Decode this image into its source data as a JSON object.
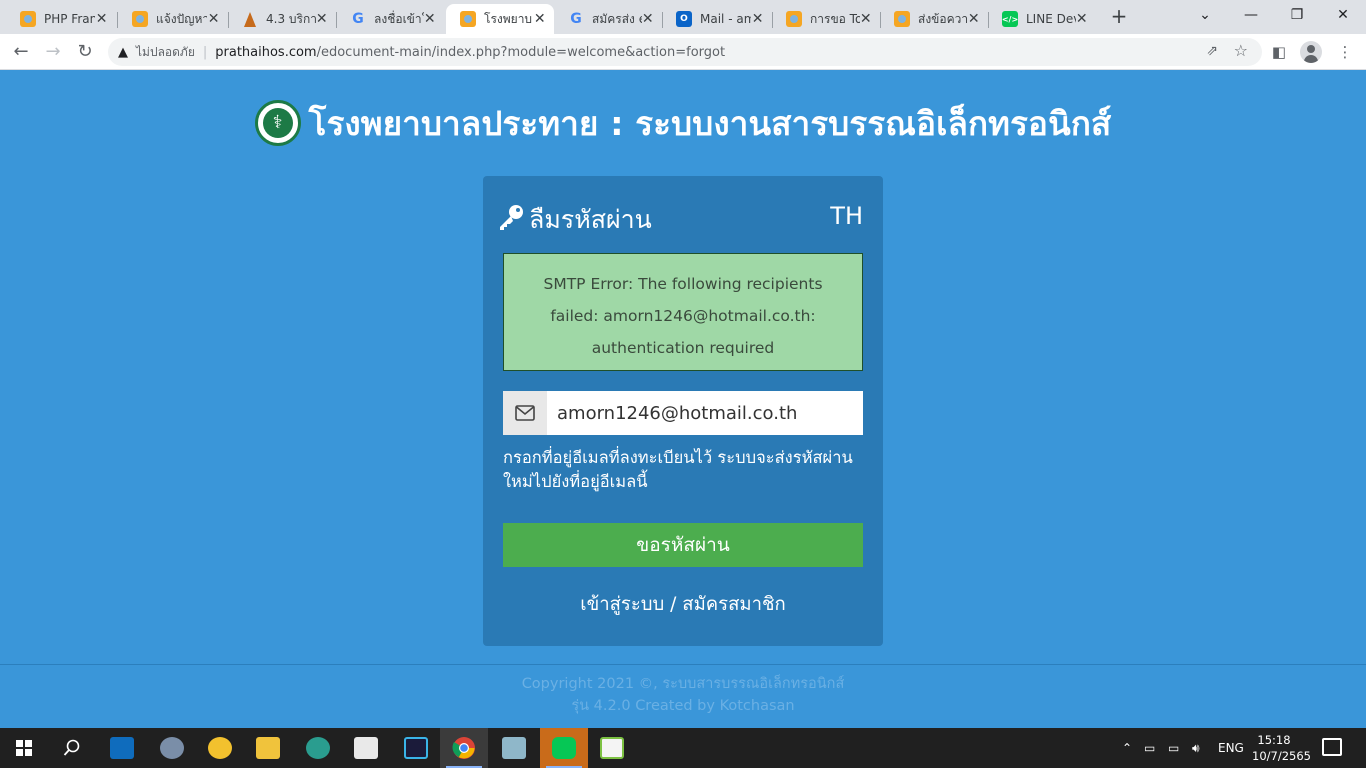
{
  "browser": {
    "tabs": [
      {
        "label": "PHP Fran",
        "icon": "orange-site-icon"
      },
      {
        "label": "แจ้งปัญหา",
        "icon": "orange-site-icon"
      },
      {
        "label": "4.3 บริการ",
        "icon": "temple-icon"
      },
      {
        "label": "ลงชื่อเข้าใ",
        "icon": "google-icon"
      },
      {
        "label": "โรงพยาบ",
        "icon": "orange-site-icon",
        "active": true
      },
      {
        "label": "สมัครส่ง e",
        "icon": "google-icon"
      },
      {
        "label": "Mail - am",
        "icon": "outlook-icon"
      },
      {
        "label": "การขอ To",
        "icon": "orange-site-icon"
      },
      {
        "label": "ส่งข้อควา",
        "icon": "orange-site-icon"
      },
      {
        "label": "LINE Dev",
        "icon": "line-dev-icon"
      }
    ],
    "address": {
      "security_label": "ไม่ปลอดภัย",
      "host": "prathaihos.com",
      "path": "/edocument-main/index.php?module=welcome&action=forgot"
    }
  },
  "page": {
    "site_title": "โรงพยาบาลประทาย : ระบบงานสารบรรณอิเล็กทรอนิกส์",
    "form_title": "ลืมรหัสผ่าน",
    "language": "TH",
    "alert_message": "SMTP Error: The following recipients failed: amorn1246@hotmail.co.th: authentication required",
    "email_value": "amorn1246@hotmail.co.th",
    "hint": "กรอกที่อยู่อีเมลที่ลงทะเบียนไว้ ระบบจะส่งรหัสผ่านใหม่ไปยังที่อยู่อีเมลนี้",
    "submit_label": "ขอรหัสผ่าน",
    "login_link": "เข้าสู่ระบบ / สมัครสมาชิก",
    "footer_line1": "Copyright 2021 ©, ระบบสารบรรณอิเล็กทรอนิกส์",
    "footer_line2": "รุ่น 4.2.0 Created by Kotchasan"
  },
  "taskbar": {
    "language": "ENG",
    "time": "15:18",
    "date": "10/7/2565"
  },
  "colors": {
    "page_bg": "#3a96d9",
    "card_bg": "#2a7ab5",
    "alert_bg": "#9fd8a6",
    "button_bg": "#4cad4e"
  }
}
